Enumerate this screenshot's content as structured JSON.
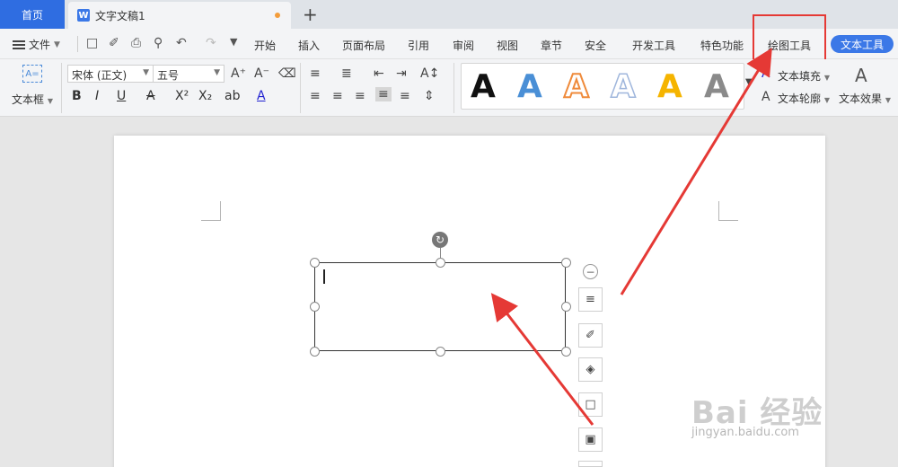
{
  "tabs": {
    "home": "首页",
    "document": "文字文稿1",
    "new_tab": "+"
  },
  "menu": {
    "file": "文件",
    "items": [
      "开始",
      "插入",
      "页面布局",
      "引用",
      "审阅",
      "视图",
      "章节",
      "安全",
      "开发工具",
      "特色功能",
      "绘图工具"
    ],
    "active": "文本工具"
  },
  "ribbon": {
    "textbox": "文本框",
    "font_name": "宋体 (正文)",
    "font_size": "五号",
    "text_fill": "文本填充",
    "text_outline": "文本轮廓",
    "text_effect": "文本效果",
    "styles": [
      {
        "glyph": "A",
        "color": "#111111"
      },
      {
        "glyph": "A",
        "color": "#4a8fd6"
      },
      {
        "glyph": "A",
        "color": "#ef8a3a"
      },
      {
        "glyph": "A",
        "color": "#9fb6dc"
      },
      {
        "glyph": "A",
        "color": "#f5b400"
      },
      {
        "glyph": "A",
        "color": "#8a8a8a"
      }
    ]
  },
  "watermark": {
    "brand": "Bai 经验",
    "url": "jingyan.baidu.com"
  },
  "colors": {
    "accent": "#3b78e7",
    "annotation": "#e53935"
  }
}
